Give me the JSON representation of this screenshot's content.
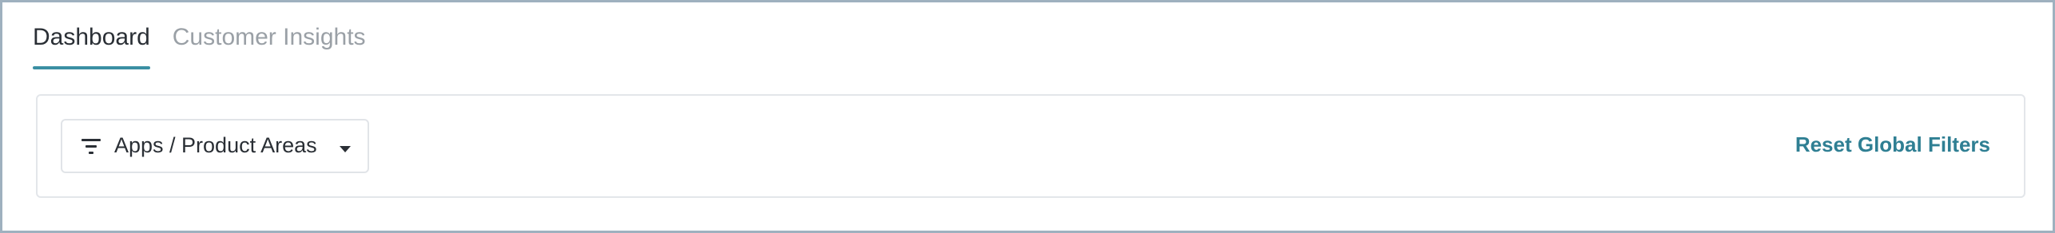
{
  "tabs": [
    {
      "label": "Dashboard",
      "active": true
    },
    {
      "label": "Customer Insights",
      "active": false
    }
  ],
  "filters": {
    "dropdown_label": "Apps / Product Areas",
    "dropdown_icon": "filter-icon",
    "caret_icon": "chevron-down-icon",
    "reset_label": "Reset Global Filters"
  },
  "colors": {
    "accent": "#3b8fa3",
    "link": "#2f7f93",
    "active_text": "#2a2f35",
    "inactive_text": "#9aa0a6",
    "border": "#e3e6ea",
    "window_border": "#9fb1bf"
  }
}
